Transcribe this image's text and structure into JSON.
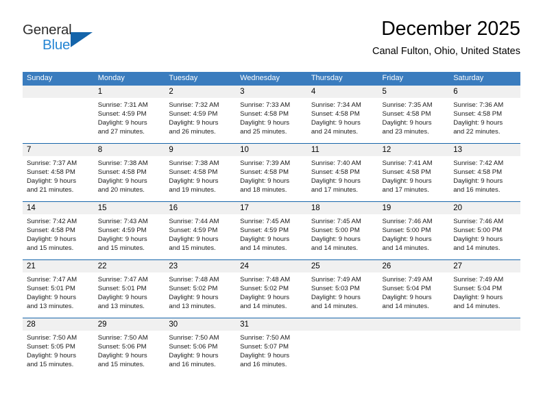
{
  "branding": {
    "name_part1": "General",
    "name_part2": "Blue"
  },
  "header": {
    "month_title": "December 2025",
    "location": "Canal Fulton, Ohio, United States"
  },
  "colors": {
    "header_blue": "#3a7cbe",
    "rule_blue": "#1464aa",
    "daynum_band": "#f0f0f0",
    "logo_blue": "#2585d3",
    "logo_triangle": "#1464aa"
  },
  "weekdays": [
    "Sunday",
    "Monday",
    "Tuesday",
    "Wednesday",
    "Thursday",
    "Friday",
    "Saturday"
  ],
  "weeks": [
    [
      {
        "day": "",
        "sunrise": "",
        "sunset": "",
        "daylight_line1": "",
        "daylight_line2": ""
      },
      {
        "day": "1",
        "sunrise": "Sunrise: 7:31 AM",
        "sunset": "Sunset: 4:59 PM",
        "daylight_line1": "Daylight: 9 hours",
        "daylight_line2": "and 27 minutes."
      },
      {
        "day": "2",
        "sunrise": "Sunrise: 7:32 AM",
        "sunset": "Sunset: 4:59 PM",
        "daylight_line1": "Daylight: 9 hours",
        "daylight_line2": "and 26 minutes."
      },
      {
        "day": "3",
        "sunrise": "Sunrise: 7:33 AM",
        "sunset": "Sunset: 4:58 PM",
        "daylight_line1": "Daylight: 9 hours",
        "daylight_line2": "and 25 minutes."
      },
      {
        "day": "4",
        "sunrise": "Sunrise: 7:34 AM",
        "sunset": "Sunset: 4:58 PM",
        "daylight_line1": "Daylight: 9 hours",
        "daylight_line2": "and 24 minutes."
      },
      {
        "day": "5",
        "sunrise": "Sunrise: 7:35 AM",
        "sunset": "Sunset: 4:58 PM",
        "daylight_line1": "Daylight: 9 hours",
        "daylight_line2": "and 23 minutes."
      },
      {
        "day": "6",
        "sunrise": "Sunrise: 7:36 AM",
        "sunset": "Sunset: 4:58 PM",
        "daylight_line1": "Daylight: 9 hours",
        "daylight_line2": "and 22 minutes."
      }
    ],
    [
      {
        "day": "7",
        "sunrise": "Sunrise: 7:37 AM",
        "sunset": "Sunset: 4:58 PM",
        "daylight_line1": "Daylight: 9 hours",
        "daylight_line2": "and 21 minutes."
      },
      {
        "day": "8",
        "sunrise": "Sunrise: 7:38 AM",
        "sunset": "Sunset: 4:58 PM",
        "daylight_line1": "Daylight: 9 hours",
        "daylight_line2": "and 20 minutes."
      },
      {
        "day": "9",
        "sunrise": "Sunrise: 7:38 AM",
        "sunset": "Sunset: 4:58 PM",
        "daylight_line1": "Daylight: 9 hours",
        "daylight_line2": "and 19 minutes."
      },
      {
        "day": "10",
        "sunrise": "Sunrise: 7:39 AM",
        "sunset": "Sunset: 4:58 PM",
        "daylight_line1": "Daylight: 9 hours",
        "daylight_line2": "and 18 minutes."
      },
      {
        "day": "11",
        "sunrise": "Sunrise: 7:40 AM",
        "sunset": "Sunset: 4:58 PM",
        "daylight_line1": "Daylight: 9 hours",
        "daylight_line2": "and 17 minutes."
      },
      {
        "day": "12",
        "sunrise": "Sunrise: 7:41 AM",
        "sunset": "Sunset: 4:58 PM",
        "daylight_line1": "Daylight: 9 hours",
        "daylight_line2": "and 17 minutes."
      },
      {
        "day": "13",
        "sunrise": "Sunrise: 7:42 AM",
        "sunset": "Sunset: 4:58 PM",
        "daylight_line1": "Daylight: 9 hours",
        "daylight_line2": "and 16 minutes."
      }
    ],
    [
      {
        "day": "14",
        "sunrise": "Sunrise: 7:42 AM",
        "sunset": "Sunset: 4:58 PM",
        "daylight_line1": "Daylight: 9 hours",
        "daylight_line2": "and 15 minutes."
      },
      {
        "day": "15",
        "sunrise": "Sunrise: 7:43 AM",
        "sunset": "Sunset: 4:59 PM",
        "daylight_line1": "Daylight: 9 hours",
        "daylight_line2": "and 15 minutes."
      },
      {
        "day": "16",
        "sunrise": "Sunrise: 7:44 AM",
        "sunset": "Sunset: 4:59 PM",
        "daylight_line1": "Daylight: 9 hours",
        "daylight_line2": "and 15 minutes."
      },
      {
        "day": "17",
        "sunrise": "Sunrise: 7:45 AM",
        "sunset": "Sunset: 4:59 PM",
        "daylight_line1": "Daylight: 9 hours",
        "daylight_line2": "and 14 minutes."
      },
      {
        "day": "18",
        "sunrise": "Sunrise: 7:45 AM",
        "sunset": "Sunset: 5:00 PM",
        "daylight_line1": "Daylight: 9 hours",
        "daylight_line2": "and 14 minutes."
      },
      {
        "day": "19",
        "sunrise": "Sunrise: 7:46 AM",
        "sunset": "Sunset: 5:00 PM",
        "daylight_line1": "Daylight: 9 hours",
        "daylight_line2": "and 14 minutes."
      },
      {
        "day": "20",
        "sunrise": "Sunrise: 7:46 AM",
        "sunset": "Sunset: 5:00 PM",
        "daylight_line1": "Daylight: 9 hours",
        "daylight_line2": "and 14 minutes."
      }
    ],
    [
      {
        "day": "21",
        "sunrise": "Sunrise: 7:47 AM",
        "sunset": "Sunset: 5:01 PM",
        "daylight_line1": "Daylight: 9 hours",
        "daylight_line2": "and 13 minutes."
      },
      {
        "day": "22",
        "sunrise": "Sunrise: 7:47 AM",
        "sunset": "Sunset: 5:01 PM",
        "daylight_line1": "Daylight: 9 hours",
        "daylight_line2": "and 13 minutes."
      },
      {
        "day": "23",
        "sunrise": "Sunrise: 7:48 AM",
        "sunset": "Sunset: 5:02 PM",
        "daylight_line1": "Daylight: 9 hours",
        "daylight_line2": "and 13 minutes."
      },
      {
        "day": "24",
        "sunrise": "Sunrise: 7:48 AM",
        "sunset": "Sunset: 5:02 PM",
        "daylight_line1": "Daylight: 9 hours",
        "daylight_line2": "and 14 minutes."
      },
      {
        "day": "25",
        "sunrise": "Sunrise: 7:49 AM",
        "sunset": "Sunset: 5:03 PM",
        "daylight_line1": "Daylight: 9 hours",
        "daylight_line2": "and 14 minutes."
      },
      {
        "day": "26",
        "sunrise": "Sunrise: 7:49 AM",
        "sunset": "Sunset: 5:04 PM",
        "daylight_line1": "Daylight: 9 hours",
        "daylight_line2": "and 14 minutes."
      },
      {
        "day": "27",
        "sunrise": "Sunrise: 7:49 AM",
        "sunset": "Sunset: 5:04 PM",
        "daylight_line1": "Daylight: 9 hours",
        "daylight_line2": "and 14 minutes."
      }
    ],
    [
      {
        "day": "28",
        "sunrise": "Sunrise: 7:50 AM",
        "sunset": "Sunset: 5:05 PM",
        "daylight_line1": "Daylight: 9 hours",
        "daylight_line2": "and 15 minutes."
      },
      {
        "day": "29",
        "sunrise": "Sunrise: 7:50 AM",
        "sunset": "Sunset: 5:06 PM",
        "daylight_line1": "Daylight: 9 hours",
        "daylight_line2": "and 15 minutes."
      },
      {
        "day": "30",
        "sunrise": "Sunrise: 7:50 AM",
        "sunset": "Sunset: 5:06 PM",
        "daylight_line1": "Daylight: 9 hours",
        "daylight_line2": "and 16 minutes."
      },
      {
        "day": "31",
        "sunrise": "Sunrise: 7:50 AM",
        "sunset": "Sunset: 5:07 PM",
        "daylight_line1": "Daylight: 9 hours",
        "daylight_line2": "and 16 minutes."
      },
      {
        "day": "",
        "sunrise": "",
        "sunset": "",
        "daylight_line1": "",
        "daylight_line2": ""
      },
      {
        "day": "",
        "sunrise": "",
        "sunset": "",
        "daylight_line1": "",
        "daylight_line2": ""
      },
      {
        "day": "",
        "sunrise": "",
        "sunset": "",
        "daylight_line1": "",
        "daylight_line2": ""
      }
    ]
  ]
}
